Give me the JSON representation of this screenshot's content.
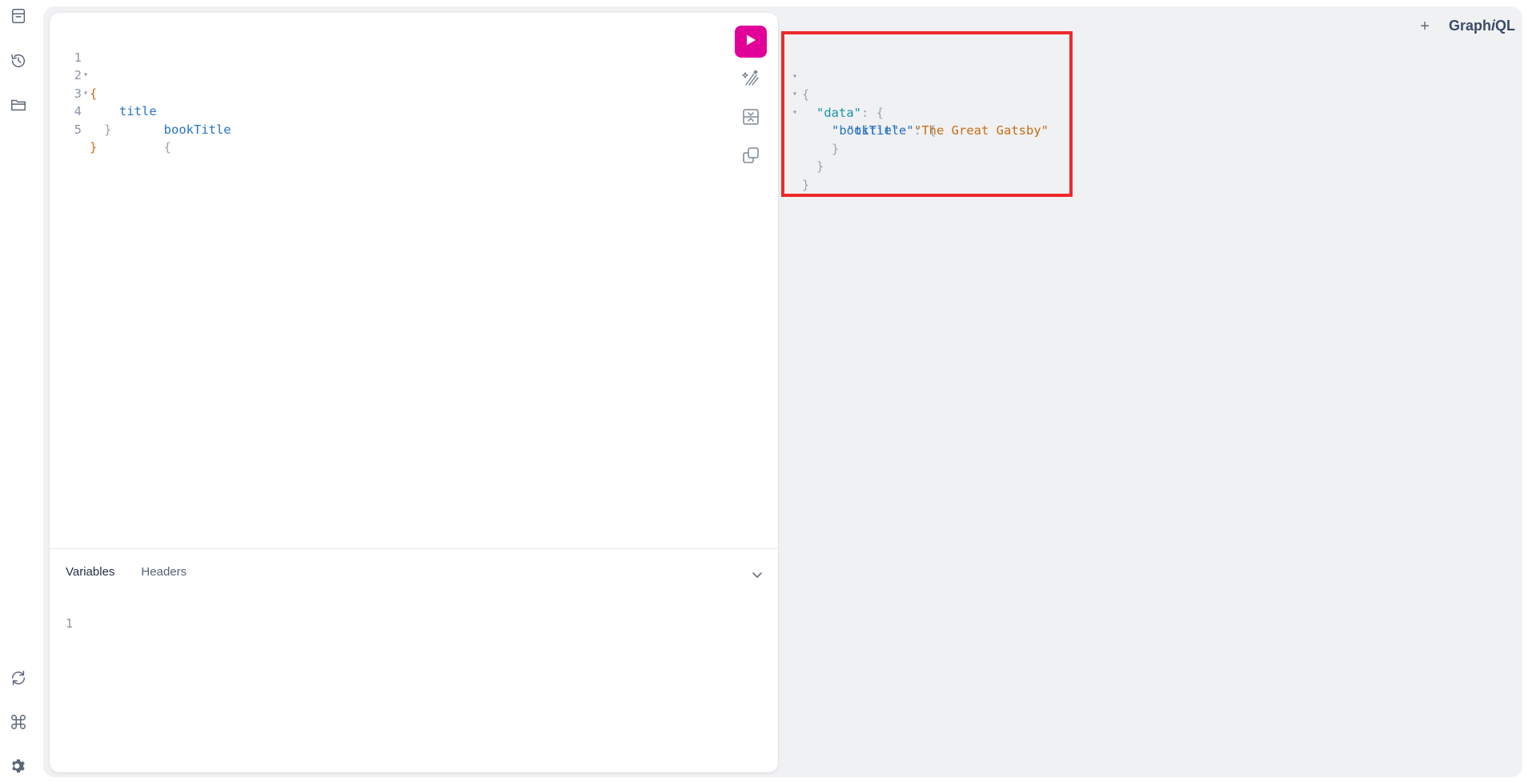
{
  "app": {
    "logo": "GraphiQL",
    "add_tab_label": "+"
  },
  "sidebar": {
    "top_items": [
      {
        "name": "documentation",
        "icon": "doc-icon"
      },
      {
        "name": "history",
        "icon": "history-icon"
      },
      {
        "name": "explorer",
        "icon": "folder-icon"
      }
    ],
    "bottom_items": [
      {
        "name": "refetch-schema",
        "icon": "refresh-icon"
      },
      {
        "name": "shortcuts",
        "icon": "command-icon"
      },
      {
        "name": "settings",
        "icon": "gear-icon"
      }
    ]
  },
  "query_editor": {
    "lines": [
      {
        "number": "1",
        "text": "{"
      },
      {
        "number": "2",
        "text": "bookTitle",
        "brace": "{"
      },
      {
        "number": "3",
        "text": "title"
      },
      {
        "number": "4",
        "text": "}"
      },
      {
        "number": "5",
        "text": "}"
      }
    ]
  },
  "toolbar": {
    "run": "run-icon",
    "prettify": "prettify-icon",
    "merge": "merge-fragments-icon",
    "copy": "copy-icon"
  },
  "variables_section": {
    "tabs": [
      "Variables",
      "Headers"
    ],
    "line_number": "1"
  },
  "result": {
    "open_brace": "{",
    "data_key": "\"data\"",
    "book_key": "\"bookTitle\"",
    "title_key": "\"title\"",
    "title_value": "\"The Great Gatsby\"",
    "colon": ":",
    "close_brace": "}"
  },
  "colors": {
    "run_button": "#e10098",
    "highlight_box": "#ee2a2a",
    "string_value": "#c66e13",
    "json_key": "#2773c5"
  }
}
